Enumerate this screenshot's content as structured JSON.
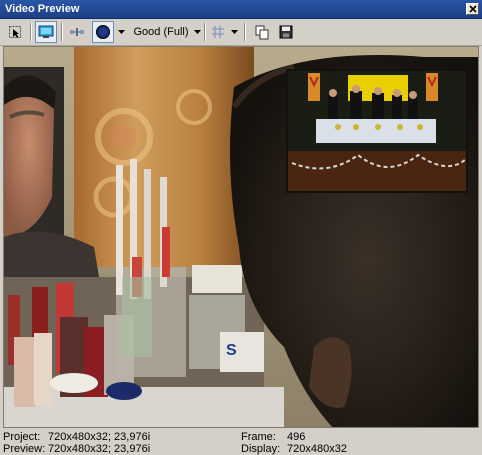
{
  "window": {
    "title": "Video Preview"
  },
  "toolbar": {
    "quality_label": "Good (Full)",
    "icons": [
      "pointer-icon",
      "monitor-icon",
      "split-icon",
      "overlay-icon",
      "grid-icon",
      "copy-icon",
      "save-icon"
    ]
  },
  "status": {
    "project_label": "Project:",
    "project_value": "720x480x32; 23,976i",
    "preview_label": "Preview:",
    "preview_value": "720x480x32; 23,976i",
    "frame_label": "Frame:",
    "frame_value": "496",
    "display_label": "Display:",
    "display_value": "720x480x32"
  },
  "colors": {
    "titlebar": "#1d3f86",
    "chrome": "#d4d0c8",
    "inset_banner": "#e8d000"
  }
}
